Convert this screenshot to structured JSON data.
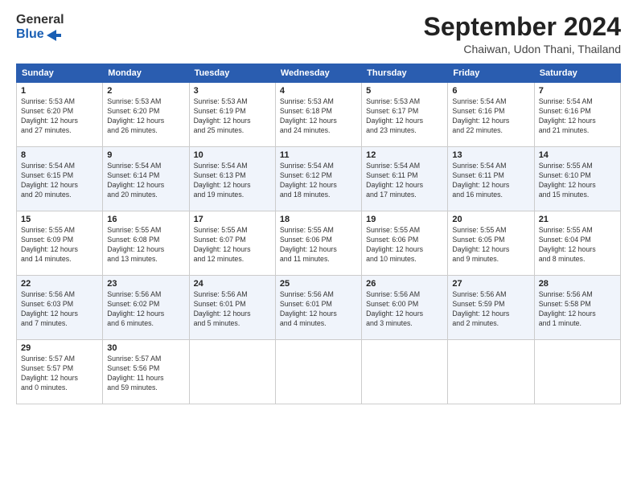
{
  "header": {
    "logo_line1": "General",
    "logo_line2": "Blue",
    "month_title": "September 2024",
    "location": "Chaiwan, Udon Thani, Thailand"
  },
  "days_of_week": [
    "Sunday",
    "Monday",
    "Tuesday",
    "Wednesday",
    "Thursday",
    "Friday",
    "Saturday"
  ],
  "weeks": [
    [
      {
        "day": "1",
        "info": "Sunrise: 5:53 AM\nSunset: 6:20 PM\nDaylight: 12 hours\nand 27 minutes."
      },
      {
        "day": "2",
        "info": "Sunrise: 5:53 AM\nSunset: 6:20 PM\nDaylight: 12 hours\nand 26 minutes."
      },
      {
        "day": "3",
        "info": "Sunrise: 5:53 AM\nSunset: 6:19 PM\nDaylight: 12 hours\nand 25 minutes."
      },
      {
        "day": "4",
        "info": "Sunrise: 5:53 AM\nSunset: 6:18 PM\nDaylight: 12 hours\nand 24 minutes."
      },
      {
        "day": "5",
        "info": "Sunrise: 5:53 AM\nSunset: 6:17 PM\nDaylight: 12 hours\nand 23 minutes."
      },
      {
        "day": "6",
        "info": "Sunrise: 5:54 AM\nSunset: 6:16 PM\nDaylight: 12 hours\nand 22 minutes."
      },
      {
        "day": "7",
        "info": "Sunrise: 5:54 AM\nSunset: 6:16 PM\nDaylight: 12 hours\nand 21 minutes."
      }
    ],
    [
      {
        "day": "8",
        "info": "Sunrise: 5:54 AM\nSunset: 6:15 PM\nDaylight: 12 hours\nand 20 minutes."
      },
      {
        "day": "9",
        "info": "Sunrise: 5:54 AM\nSunset: 6:14 PM\nDaylight: 12 hours\nand 20 minutes."
      },
      {
        "day": "10",
        "info": "Sunrise: 5:54 AM\nSunset: 6:13 PM\nDaylight: 12 hours\nand 19 minutes."
      },
      {
        "day": "11",
        "info": "Sunrise: 5:54 AM\nSunset: 6:12 PM\nDaylight: 12 hours\nand 18 minutes."
      },
      {
        "day": "12",
        "info": "Sunrise: 5:54 AM\nSunset: 6:11 PM\nDaylight: 12 hours\nand 17 minutes."
      },
      {
        "day": "13",
        "info": "Sunrise: 5:54 AM\nSunset: 6:11 PM\nDaylight: 12 hours\nand 16 minutes."
      },
      {
        "day": "14",
        "info": "Sunrise: 5:55 AM\nSunset: 6:10 PM\nDaylight: 12 hours\nand 15 minutes."
      }
    ],
    [
      {
        "day": "15",
        "info": "Sunrise: 5:55 AM\nSunset: 6:09 PM\nDaylight: 12 hours\nand 14 minutes."
      },
      {
        "day": "16",
        "info": "Sunrise: 5:55 AM\nSunset: 6:08 PM\nDaylight: 12 hours\nand 13 minutes."
      },
      {
        "day": "17",
        "info": "Sunrise: 5:55 AM\nSunset: 6:07 PM\nDaylight: 12 hours\nand 12 minutes."
      },
      {
        "day": "18",
        "info": "Sunrise: 5:55 AM\nSunset: 6:06 PM\nDaylight: 12 hours\nand 11 minutes."
      },
      {
        "day": "19",
        "info": "Sunrise: 5:55 AM\nSunset: 6:06 PM\nDaylight: 12 hours\nand 10 minutes."
      },
      {
        "day": "20",
        "info": "Sunrise: 5:55 AM\nSunset: 6:05 PM\nDaylight: 12 hours\nand 9 minutes."
      },
      {
        "day": "21",
        "info": "Sunrise: 5:55 AM\nSunset: 6:04 PM\nDaylight: 12 hours\nand 8 minutes."
      }
    ],
    [
      {
        "day": "22",
        "info": "Sunrise: 5:56 AM\nSunset: 6:03 PM\nDaylight: 12 hours\nand 7 minutes."
      },
      {
        "day": "23",
        "info": "Sunrise: 5:56 AM\nSunset: 6:02 PM\nDaylight: 12 hours\nand 6 minutes."
      },
      {
        "day": "24",
        "info": "Sunrise: 5:56 AM\nSunset: 6:01 PM\nDaylight: 12 hours\nand 5 minutes."
      },
      {
        "day": "25",
        "info": "Sunrise: 5:56 AM\nSunset: 6:01 PM\nDaylight: 12 hours\nand 4 minutes."
      },
      {
        "day": "26",
        "info": "Sunrise: 5:56 AM\nSunset: 6:00 PM\nDaylight: 12 hours\nand 3 minutes."
      },
      {
        "day": "27",
        "info": "Sunrise: 5:56 AM\nSunset: 5:59 PM\nDaylight: 12 hours\nand 2 minutes."
      },
      {
        "day": "28",
        "info": "Sunrise: 5:56 AM\nSunset: 5:58 PM\nDaylight: 12 hours\nand 1 minute."
      }
    ],
    [
      {
        "day": "29",
        "info": "Sunrise: 5:57 AM\nSunset: 5:57 PM\nDaylight: 12 hours\nand 0 minutes."
      },
      {
        "day": "30",
        "info": "Sunrise: 5:57 AM\nSunset: 5:56 PM\nDaylight: 11 hours\nand 59 minutes."
      },
      {
        "day": "",
        "info": ""
      },
      {
        "day": "",
        "info": ""
      },
      {
        "day": "",
        "info": ""
      },
      {
        "day": "",
        "info": ""
      },
      {
        "day": "",
        "info": ""
      }
    ]
  ]
}
